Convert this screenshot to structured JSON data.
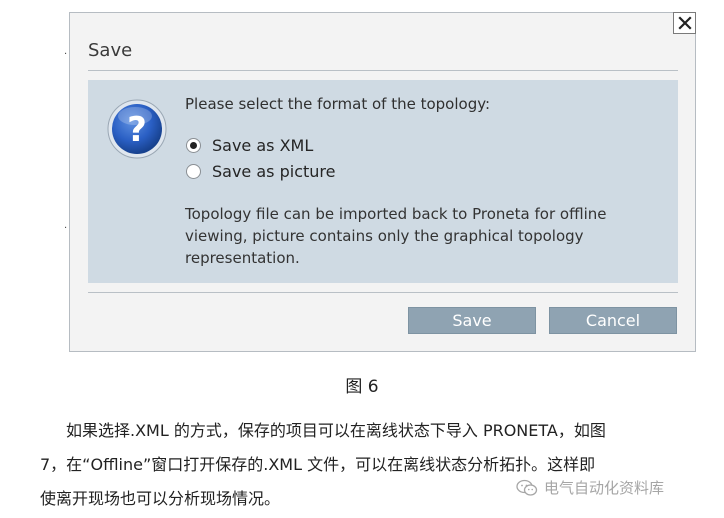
{
  "dialog": {
    "title": "Save",
    "close_label": "×",
    "prompt": "Please select the format of the topology:",
    "options": [
      {
        "label": "Save as XML",
        "selected": true
      },
      {
        "label": "Save as picture",
        "selected": false
      }
    ],
    "info_lines": [
      "Topology file can be imported back to Proneta for offline",
      "viewing, picture contains only the graphical topology",
      "representation."
    ],
    "buttons": {
      "save": "Save",
      "cancel": "Cancel"
    },
    "icon": "question-icon"
  },
  "document": {
    "caption": "图 6",
    "paragraph_lines": [
      "如果选择.XML 的方式，保存的项目可以在离线状态下导入 PRONETA，如图",
      "7，在“Offline”窗口打开保存的.XML 文件，可以在离线状态分析拓扑。这样即",
      "使离开现场也可以分析现场情况。"
    ]
  },
  "watermark": {
    "text": "电气自动化资料库",
    "icon": "wechat-icon"
  },
  "colors": {
    "panel": "#cfdae3",
    "button": "#8fa3b2",
    "dialog_bg": "#f3f3f3"
  }
}
